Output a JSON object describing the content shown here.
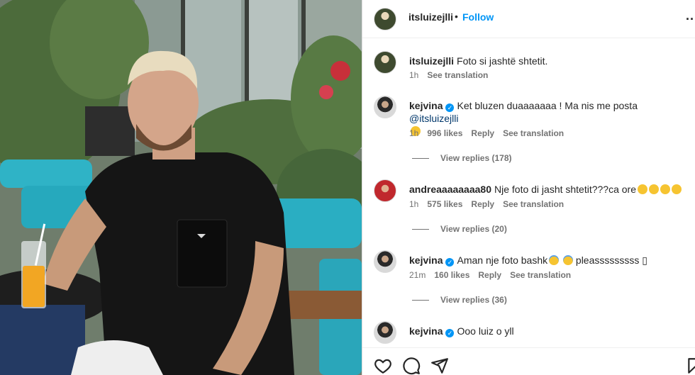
{
  "post": {
    "owner_username": "itsluizejlli",
    "follow_label": "Follow",
    "separator": "•",
    "more_label": "..."
  },
  "caption": {
    "username": "itsluizejlli",
    "text": "Foto si jashtë shtetit.",
    "time": "1h",
    "see_translation": "See translation"
  },
  "comments": [
    {
      "username": "kejvina",
      "verified": true,
      "text": "Ket bluzen duaaaaaaa ! Ma nis me posta ",
      "mention": "@itsluizejlli",
      "time": "1h",
      "likes": "996 likes",
      "reply": "Reply",
      "see_translation": "See translation",
      "view_replies": "View replies (178)"
    },
    {
      "username": "andreaaaaaaaa80",
      "verified": false,
      "text": "Nje foto di jasht shtetit???ca ore",
      "time": "1h",
      "likes": "575 likes",
      "reply": "Reply",
      "see_translation": "See translation",
      "view_replies": "View replies (20)"
    },
    {
      "username": "kejvina",
      "verified": true,
      "text": "Aman nje foto bashk",
      "text_after": "pleasssssssss ",
      "glyph": "▯",
      "time": "21m",
      "likes": "160 likes",
      "reply": "Reply",
      "see_translation": "See translation",
      "view_replies": "View replies (36)"
    },
    {
      "username": "kejvina",
      "verified": true,
      "text": "Ooo luiz o yll"
    }
  ],
  "actions": {
    "like_icon": "heart-icon",
    "comment_icon": "comment-icon",
    "share_icon": "share-icon",
    "save_icon": "bookmark-icon"
  },
  "colors": {
    "link_blue": "#0095f6",
    "mention": "#00376b",
    "secondary_text": "#737373",
    "verified_badge": "#0095f6"
  }
}
